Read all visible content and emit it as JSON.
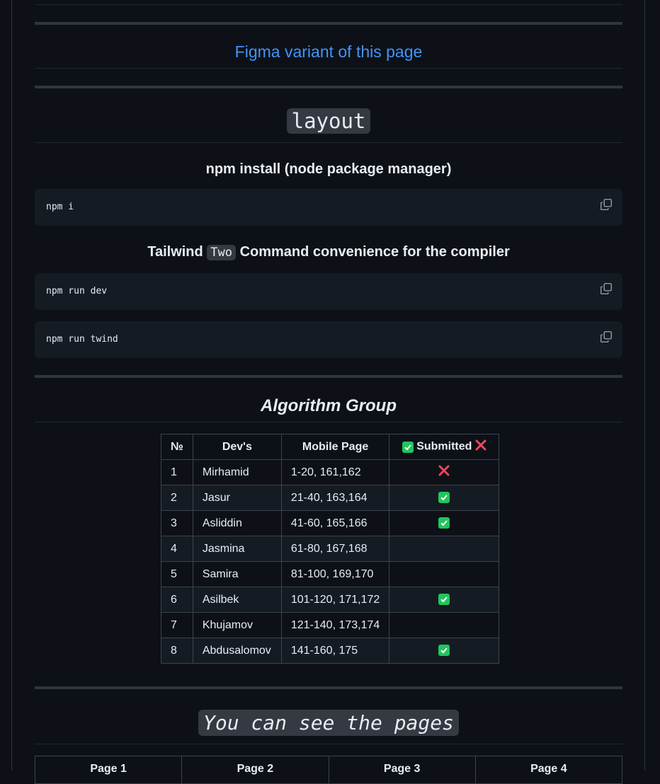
{
  "figma_link": "Figma variant of this page",
  "layout_heading": "layout",
  "npm_install": {
    "heading": "npm install (node package manager)",
    "command": "npm i"
  },
  "tailwind": {
    "heading_before": "Tailwind",
    "heading_code": "Two",
    "heading_after": "Command convenience for the compiler",
    "commands": [
      "npm run dev",
      "npm run twind"
    ]
  },
  "algorithm": {
    "heading": "Algorithm Group",
    "columns": [
      "№",
      "Dev's",
      "Mobile Page",
      "Submitted"
    ],
    "rows": [
      {
        "n": "1",
        "dev": "Mirhamid",
        "pages": "1-20, 161,162",
        "status": "no"
      },
      {
        "n": "2",
        "dev": "Jasur",
        "pages": "21-40, 163,164",
        "status": "yes"
      },
      {
        "n": "3",
        "dev": "Asliddin",
        "pages": "41-60, 165,166",
        "status": "yes"
      },
      {
        "n": "4",
        "dev": "Jasmina",
        "pages": "61-80, 167,168",
        "status": ""
      },
      {
        "n": "5",
        "dev": "Samira",
        "pages": "81-100, 169,170",
        "status": ""
      },
      {
        "n": "6",
        "dev": "Asilbek",
        "pages": "101-120, 171,172",
        "status": "yes"
      },
      {
        "n": "7",
        "dev": "Khujamov",
        "pages": "121-140, 173,174",
        "status": ""
      },
      {
        "n": "8",
        "dev": "Abdusalomov",
        "pages": "141-160, 175",
        "status": "yes"
      }
    ]
  },
  "pages_heading": "You can see the pages",
  "pages_columns": [
    "Page 1",
    "Page 2",
    "Page 3",
    "Page 4"
  ],
  "colors": {
    "background": "#0d1117",
    "link": "#4493f8",
    "check": "#21c55d",
    "cross": "#f0455e"
  },
  "icons": {
    "copy": "copy-icon",
    "check": "check-mark-button-icon",
    "cross": "cross-mark-icon"
  }
}
